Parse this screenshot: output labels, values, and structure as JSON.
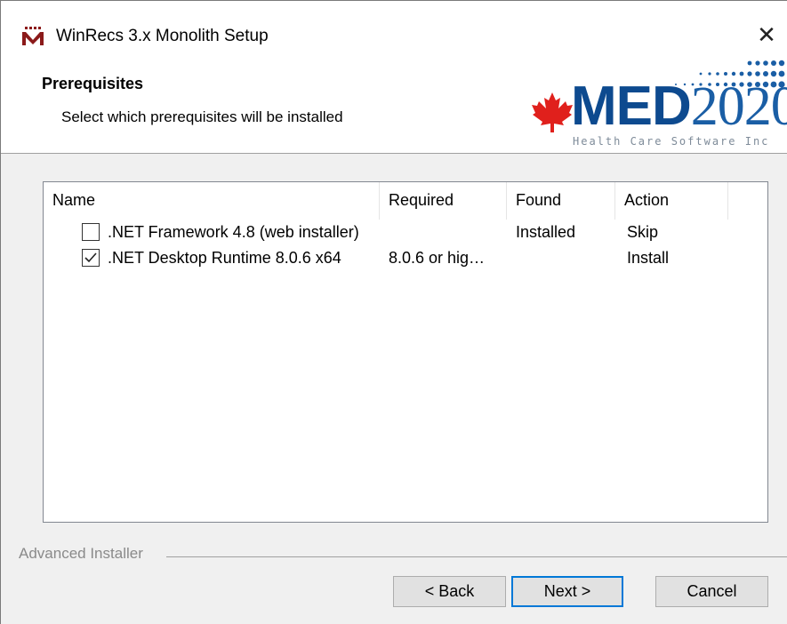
{
  "window": {
    "title": "WinRecs 3.x Monolith Setup",
    "close_glyph": "✕"
  },
  "header": {
    "title": "Prerequisites",
    "subtitle": "Select which prerequisites will be installed"
  },
  "logo": {
    "text_main": "MED",
    "text_num": "2020",
    "tagline": "Health Care Software Inc"
  },
  "table": {
    "columns": [
      "Name",
      "Required",
      "Found",
      "Action"
    ],
    "rows": [
      {
        "checked": false,
        "name": ".NET Framework 4.8 (web installer)",
        "required": "",
        "found": "Installed",
        "action": "Skip"
      },
      {
        "checked": true,
        "name": ".NET Desktop Runtime 8.0.6 x64",
        "required": "8.0.6 or hig…",
        "found": "",
        "action": "Install"
      }
    ]
  },
  "footer": {
    "branding": "Advanced Installer",
    "back_label": "< Back",
    "next_label": "Next >",
    "cancel_label": "Cancel"
  },
  "colors": {
    "brand_blue": "#0d4a8f",
    "maple_red": "#e0201c",
    "focus_border": "#0078d7"
  }
}
